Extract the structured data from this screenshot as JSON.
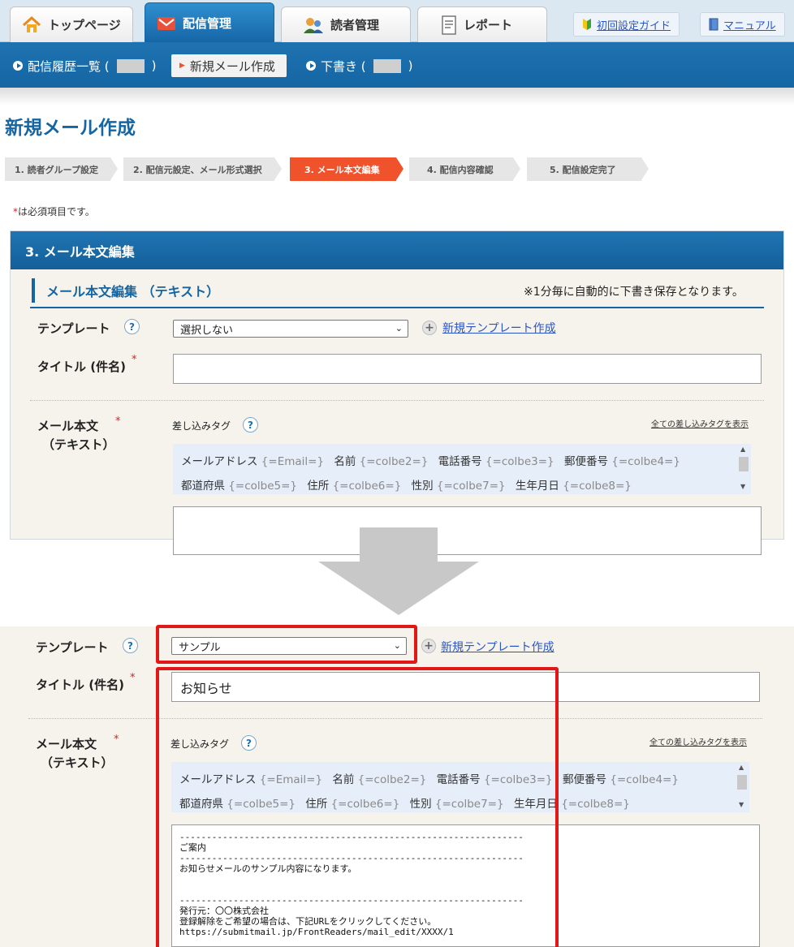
{
  "tabs": [
    {
      "label": "トップページ",
      "icon": "home-icon"
    },
    {
      "label": "配信管理",
      "icon": "mail-icon"
    },
    {
      "label": "読者管理",
      "icon": "readers-icon"
    },
    {
      "label": "レポート",
      "icon": "report-icon"
    }
  ],
  "top_buttons": [
    {
      "label": "初回設定ガイド",
      "icon": "beginner-mark-icon"
    },
    {
      "label": "マニュアル",
      "icon": "book-icon"
    }
  ],
  "subnav": {
    "history": {
      "label_prefix": "配信履歴一覧 (",
      "label_suffix": ")"
    },
    "new_mail": {
      "label": "新規メール作成"
    },
    "drafts": {
      "label_prefix": "下書き (",
      "label_suffix": ")"
    }
  },
  "page_title": "新規メール作成",
  "steps": [
    "1. 読者グループ設定",
    "2. 配信元設定、メール形式選択",
    "3. メール本文編集",
    "4. 配信内容確認",
    "5. 配信設定完了"
  ],
  "required_note": {
    "star": "*",
    "text": "は必須項目です。"
  },
  "panel_title": "3. メール本文編集",
  "section_title": "メール本文編集 （テキスト）",
  "autosave_note": "※1分毎に自動的に下書き保存となります。",
  "labels": {
    "template": "テンプレート",
    "title": "タイトル (件名)",
    "body_line1": "メール本文",
    "body_line2": "（テキスト）",
    "insert_tags": "差し込みタグ",
    "show_all_tags": "全ての差し込みタグを表示",
    "new_template": "新規テンプレート作成",
    "required_star": "*",
    "help": "?"
  },
  "tags_row1": [
    {
      "name": "メールアドレス",
      "value": "{=Email=}"
    },
    {
      "name": "名前",
      "value": "{=colbe2=}"
    },
    {
      "name": "電話番号",
      "value": "{=colbe3=}"
    },
    {
      "name": "郵便番号",
      "value": "{=colbe4=}"
    }
  ],
  "tags_row2": [
    {
      "name": "都道府県",
      "value": "{=colbe5=}"
    },
    {
      "name": "住所",
      "value": "{=colbe6=}"
    },
    {
      "name": "性別",
      "value": "{=colbe7=}"
    },
    {
      "name": "生年月日",
      "value": "{=colbe8=}"
    }
  ],
  "before": {
    "template_value": "選択しない",
    "title_value": ""
  },
  "after": {
    "template_value": "サンプル",
    "title_value": "お知らせ",
    "body_lines": [
      "----------------------------------------------------------------",
      "ご案内",
      "----------------------------------------------------------------",
      "お知らせメールのサンプル内容になります。",
      "",
      "",
      "----------------------------------------------------------------",
      "発行元：〇〇株式会社",
      "登録解除をご希望の場合は、下記URLをクリックしてください。",
      "https://submitmail.jp/FrontReaders/mail_edit/XXXX/1"
    ]
  },
  "colors": {
    "brand_blue": "#1565a3",
    "active_step": "#f0522c",
    "highlight_red": "#e01818"
  }
}
